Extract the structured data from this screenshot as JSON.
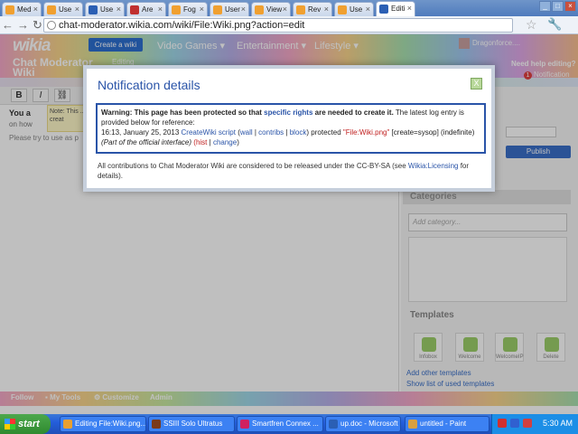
{
  "browser": {
    "tabs": [
      {
        "label": "Med",
        "active": false
      },
      {
        "label": "Use",
        "active": false
      },
      {
        "label": "Use",
        "active": false
      },
      {
        "label": "Are",
        "active": false
      },
      {
        "label": "Fog",
        "active": false
      },
      {
        "label": "User",
        "active": false
      },
      {
        "label": "View",
        "active": false
      },
      {
        "label": "Rev",
        "active": false
      },
      {
        "label": "Use",
        "active": false
      },
      {
        "label": "Editi",
        "active": true
      }
    ],
    "url": "chat-moderator.wikia.com/wiki/File:Wiki.png?action=edit"
  },
  "wikia_header": {
    "logo": "wikia",
    "create_wiki": "Create a wiki",
    "nav": [
      "Video Games",
      "Entertainment",
      "Lifestyle"
    ],
    "username": "Dragonforce....",
    "wiki_name": "Chat Moderator Wiki",
    "editing_label": "Editing",
    "help_editing": "Need help editing?",
    "notifications_count": "1",
    "notifications_label": "Notification"
  },
  "editor": {
    "toolbar": [
      "B",
      "I",
      "link"
    ],
    "you_are_text": "You a",
    "note_text": "Note: This ... can creat",
    "on_how_text": "on how",
    "try_use_text": "Please try to use as p"
  },
  "rail": {
    "publish_label": "Publish",
    "categories_title": "Categories",
    "add_category_placeholder": "Add category...",
    "templates_title": "Templates",
    "templates": [
      "Infobox",
      "Welcome",
      "WelcomeIP",
      "Delete"
    ],
    "add_templates": "Add other templates",
    "list_templates": "Show list of used templates"
  },
  "wikia_bar": {
    "items": [
      "Follow",
      "My Tools",
      "Customize",
      "Admin"
    ]
  },
  "modal": {
    "title": "Notification details",
    "close_label": "X",
    "warning_bold_1": "Warning: This page has been protected so that ",
    "warning_link": "specific rights",
    "warning_bold_2": " are needed to create it.",
    "warning_rest": " The latest log entry is provided below for reference:",
    "log_time": "16:13, January 25, 2013 ",
    "log_user": "CreateWiki script",
    "log_wall": "wall",
    "log_contribs": "contribs",
    "log_block": "block",
    "log_action": ") protected ",
    "log_page": "\"File:Wiki.png\"",
    "log_params": " [create=sysop] (indefinite) ",
    "log_iface": "(Part of the official interface)",
    "log_hist": "hist",
    "log_change": "change",
    "footer_text": "All contributions to Chat Moderator Wiki are considered to be released under the CC-BY-SA (see ",
    "footer_link": "Wikia:Licensing",
    "footer_end": " for details)."
  },
  "taskbar": {
    "start": "start",
    "tasks": [
      {
        "label": "Editing File:Wiki.png...",
        "color": "#e8a030"
      },
      {
        "label": "SSIII Solo Ultratus",
        "color": "#7a3a1a"
      },
      {
        "label": "Smartfren Connex ...",
        "color": "#d02060"
      },
      {
        "label": "up.doc - Microsoft ...",
        "color": "#2b5fb4"
      },
      {
        "label": "untitled - Paint",
        "color": "#d8a040"
      }
    ],
    "clock": "5:30 AM"
  }
}
